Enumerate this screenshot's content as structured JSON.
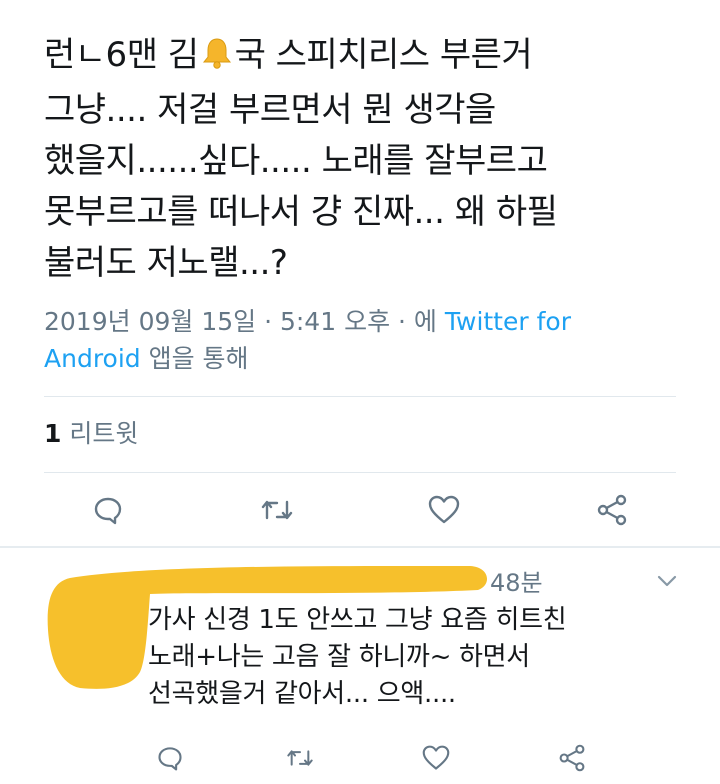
{
  "tweet": {
    "text_before_bell": "런ㄴ6맨 김",
    "text_after_bell": "국 스피치리스 부른거\n그냥.... 저걸 부르면서 뭔 생각을\n했을지......싶다..... 노래를 잘부르고\n못부르고를 떠나서 걍 진짜... 왜 하필\n불러도 저노랠...?",
    "emoji_icon": "bell-icon",
    "timestamp": "2019년 09월 15일 · 5:41 오후 · 에 ",
    "source_app": "Twitter for Android",
    "source_suffix": " 앱을 통해",
    "retweet_count": "1",
    "retweet_label": "리트윗"
  },
  "actions": {
    "icons": [
      "reply-icon",
      "retweet-icon",
      "like-icon",
      "share-icon"
    ]
  },
  "reply": {
    "time_ago": "48분",
    "text": "가사 신경 1도 안쓰고 그냥 요즘 히트친\n노래+나는 고음 잘 하니까~ 하면서\n선곡했을거 같아서... 으액....",
    "redaction_color": "#f6c02c"
  },
  "colors": {
    "text": "#14171a",
    "secondary": "#657786",
    "link": "#1da1f2",
    "divider": "#e1e8ed"
  }
}
